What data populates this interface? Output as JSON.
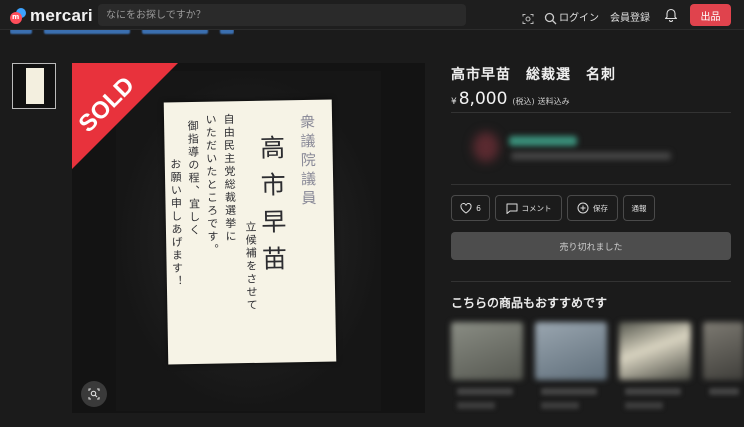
{
  "header": {
    "logo_text": "mercari",
    "logo_mark": "m",
    "search_placeholder": "なにをお探しですか？",
    "login_label": "ログイン",
    "register_label": "会員登録",
    "sell_label": "出品",
    "icons": [
      "camera-search-icon",
      "search-icon",
      "bell-icon"
    ],
    "sell_color": "#e0434d"
  },
  "gallery": {
    "sold_label": "SOLD",
    "sold_color": "#e8323c",
    "card": {
      "title": "衆議院議員",
      "name": "高市早苗",
      "message_lines": [
        "自由民主党総裁選挙に",
        "立候補をさせて",
        "いただいたところです。",
        "御指導の程、宜しく",
        "お願い申しあげます！"
      ]
    },
    "zoom_icon": "scan-zoom-icon"
  },
  "product": {
    "title": "高市早苗　総裁選　名刺",
    "price_symbol": "¥",
    "price": "8,000",
    "tax_note": "(税込)",
    "shipping_note": "送料込み"
  },
  "actions": {
    "like_label": "6",
    "comment_label": "コメント",
    "save_label": "保存",
    "report_label": "通報"
  },
  "soldout_label": "売り切れました",
  "recommend": {
    "heading": "こちらの商品もおすすめです"
  }
}
